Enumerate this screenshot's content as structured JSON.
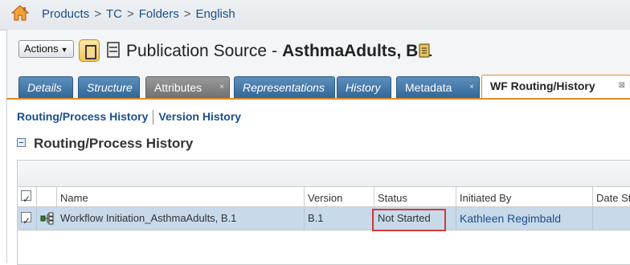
{
  "breadcrumb": {
    "items": [
      "Products",
      "TC",
      "Folders",
      "English"
    ],
    "separator": ">"
  },
  "object_header": {
    "actions_label": "Actions",
    "title_type": "Publication Source",
    "title_dash": "-",
    "title_name": "AsthmaAdults, B.1"
  },
  "tabs": [
    {
      "label": "Details"
    },
    {
      "label": "Structure"
    },
    {
      "label": "Attributes",
      "close": "×"
    },
    {
      "label": "Representations"
    },
    {
      "label": "History"
    },
    {
      "label": "Metadata",
      "close": "×"
    },
    {
      "label": "WF Routing/History",
      "close": "⊠"
    }
  ],
  "subnav": {
    "routing_link": "Routing/Process History",
    "version_link": "Version History"
  },
  "section": {
    "title": "Routing/Process History"
  },
  "grid": {
    "columns": {
      "name": "Name",
      "version": "Version",
      "status": "Status",
      "initiated_by": "Initiated By",
      "date_started": "Date St"
    },
    "rows": [
      {
        "name": "Workflow Initiation_AsthmaAdults, B.1",
        "version": "B.1",
        "status": "Not Started",
        "initiated_by": "Kathleen Regimbald",
        "date_started": ""
      }
    ]
  },
  "colors": {
    "link": "#1a4f8b",
    "tab_blue": "#3f73a4",
    "tab_gray": "#7f7f7f",
    "active_tab_border": "#e08a2a",
    "selected_row": "#c8d9ea",
    "highlight_box": "#d43a3a"
  },
  "icons": [
    "home-icon",
    "publication-source-icon",
    "list-icon",
    "document-icon",
    "collapse-icon",
    "workflow-icon",
    "checkbox-icon"
  ]
}
